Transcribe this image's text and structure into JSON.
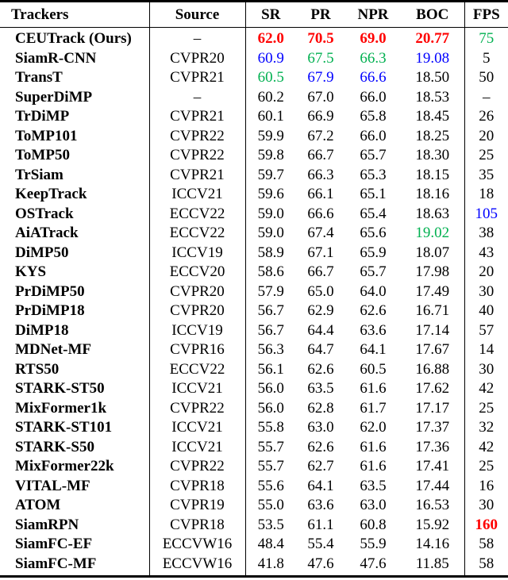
{
  "table": {
    "headers": [
      "Trackers",
      "Source",
      "SR",
      "PR",
      "NPR",
      "BOC",
      "FPS"
    ],
    "rank_colors": {
      "best": "#ff0000",
      "second": "#0000ff",
      "third": "#00b050"
    },
    "rows": [
      {
        "tracker": "CEUTrack (Ours)",
        "source": "–",
        "sr": "62.0",
        "pr": "70.5",
        "npr": "69.0",
        "boc": "20.77",
        "fps": "75",
        "rank": {
          "sr": "best",
          "pr": "best",
          "npr": "best",
          "boc": "best",
          "fps": "third"
        }
      },
      {
        "tracker": "SiamR-CNN",
        "source": "CVPR20",
        "sr": "60.9",
        "pr": "67.5",
        "npr": "66.3",
        "boc": "19.08",
        "fps": "5",
        "rank": {
          "sr": "second",
          "pr": "third",
          "npr": "third",
          "boc": "second"
        }
      },
      {
        "tracker": "TransT",
        "source": "CVPR21",
        "sr": "60.5",
        "pr": "67.9",
        "npr": "66.6",
        "boc": "18.50",
        "fps": "50",
        "rank": {
          "sr": "third",
          "pr": "second",
          "npr": "second"
        }
      },
      {
        "tracker": "SuperDiMP",
        "source": "–",
        "sr": "60.2",
        "pr": "67.0",
        "npr": "66.0",
        "boc": "18.53",
        "fps": "–",
        "rank": {}
      },
      {
        "tracker": "TrDiMP",
        "source": "CVPR21",
        "sr": "60.1",
        "pr": "66.9",
        "npr": "65.8",
        "boc": "18.45",
        "fps": "26",
        "rank": {}
      },
      {
        "tracker": "ToMP101",
        "source": "CVPR22",
        "sr": "59.9",
        "pr": "67.2",
        "npr": "66.0",
        "boc": "18.25",
        "fps": "20",
        "rank": {}
      },
      {
        "tracker": "ToMP50",
        "source": "CVPR22",
        "sr": "59.8",
        "pr": "66.7",
        "npr": "65.7",
        "boc": "18.30",
        "fps": "25",
        "rank": {}
      },
      {
        "tracker": "TrSiam",
        "source": "CVPR21",
        "sr": "59.7",
        "pr": "66.3",
        "npr": "65.3",
        "boc": "18.15",
        "fps": "35",
        "rank": {}
      },
      {
        "tracker": "KeepTrack",
        "source": "ICCV21",
        "sr": "59.6",
        "pr": "66.1",
        "npr": "65.1",
        "boc": "18.16",
        "fps": "18",
        "rank": {}
      },
      {
        "tracker": "OSTrack",
        "source": "ECCV22",
        "sr": "59.0",
        "pr": "66.6",
        "npr": "65.4",
        "boc": "18.63",
        "fps": "105",
        "rank": {
          "fps": "second"
        }
      },
      {
        "tracker": "AiATrack",
        "source": "ECCV22",
        "sr": "59.0",
        "pr": "67.4",
        "npr": "65.6",
        "boc": "19.02",
        "fps": "38",
        "rank": {
          "boc": "third"
        }
      },
      {
        "tracker": "DiMP50",
        "source": "ICCV19",
        "sr": "58.9",
        "pr": "67.1",
        "npr": "65.9",
        "boc": "18.07",
        "fps": "43",
        "rank": {}
      },
      {
        "tracker": "KYS",
        "source": "ECCV20",
        "sr": "58.6",
        "pr": "66.7",
        "npr": "65.7",
        "boc": "17.98",
        "fps": "20",
        "rank": {}
      },
      {
        "tracker": "PrDiMP50",
        "source": "CVPR20",
        "sr": "57.9",
        "pr": "65.0",
        "npr": "64.0",
        "boc": "17.49",
        "fps": "30",
        "rank": {}
      },
      {
        "tracker": "PrDiMP18",
        "source": "CVPR20",
        "sr": "56.7",
        "pr": "62.9",
        "npr": "62.6",
        "boc": "16.71",
        "fps": "40",
        "rank": {}
      },
      {
        "tracker": "DiMP18",
        "source": "ICCV19",
        "sr": "56.7",
        "pr": "64.4",
        "npr": "63.6",
        "boc": "17.14",
        "fps": "57",
        "rank": {}
      },
      {
        "tracker": "MDNet-MF",
        "source": "CVPR16",
        "sr": "56.3",
        "pr": "64.7",
        "npr": "64.1",
        "boc": "17.67",
        "fps": "14",
        "rank": {}
      },
      {
        "tracker": "RTS50",
        "source": "ECCV22",
        "sr": "56.1",
        "pr": "62.6",
        "npr": "60.5",
        "boc": "16.88",
        "fps": "30",
        "rank": {}
      },
      {
        "tracker": "STARK-ST50",
        "source": "ICCV21",
        "sr": "56.0",
        "pr": "63.5",
        "npr": "61.6",
        "boc": "17.62",
        "fps": "42",
        "rank": {}
      },
      {
        "tracker": "MixFormer1k",
        "source": "CVPR22",
        "sr": "56.0",
        "pr": "62.8",
        "npr": "61.7",
        "boc": "17.17",
        "fps": "25",
        "rank": {}
      },
      {
        "tracker": "STARK-ST101",
        "source": "ICCV21",
        "sr": "55.8",
        "pr": "63.0",
        "npr": "62.0",
        "boc": "17.37",
        "fps": "32",
        "rank": {}
      },
      {
        "tracker": "STARK-S50",
        "source": "ICCV21",
        "sr": "55.7",
        "pr": "62.6",
        "npr": "61.6",
        "boc": "17.36",
        "fps": "42",
        "rank": {}
      },
      {
        "tracker": "MixFormer22k",
        "source": "CVPR22",
        "sr": "55.7",
        "pr": "62.7",
        "npr": "61.6",
        "boc": "17.41",
        "fps": "25",
        "rank": {}
      },
      {
        "tracker": "VITAL-MF",
        "source": "CVPR18",
        "sr": "55.6",
        "pr": "64.1",
        "npr": "63.5",
        "boc": "17.44",
        "fps": "16",
        "rank": {}
      },
      {
        "tracker": "ATOM",
        "source": "CVPR19",
        "sr": "55.0",
        "pr": "63.6",
        "npr": "63.0",
        "boc": "16.53",
        "fps": "30",
        "rank": {}
      },
      {
        "tracker": "SiamRPN",
        "source": "CVPR18",
        "sr": "53.5",
        "pr": "61.1",
        "npr": "60.8",
        "boc": "15.92",
        "fps": "160",
        "rank": {
          "fps": "best"
        }
      },
      {
        "tracker": "SiamFC-EF",
        "source": "ECCVW16",
        "sr": "48.4",
        "pr": "55.4",
        "npr": "55.9",
        "boc": "14.16",
        "fps": "58",
        "rank": {}
      },
      {
        "tracker": "SiamFC-MF",
        "source": "ECCVW16",
        "sr": "41.8",
        "pr": "47.6",
        "npr": "47.6",
        "boc": "11.85",
        "fps": "58",
        "rank": {}
      }
    ]
  }
}
